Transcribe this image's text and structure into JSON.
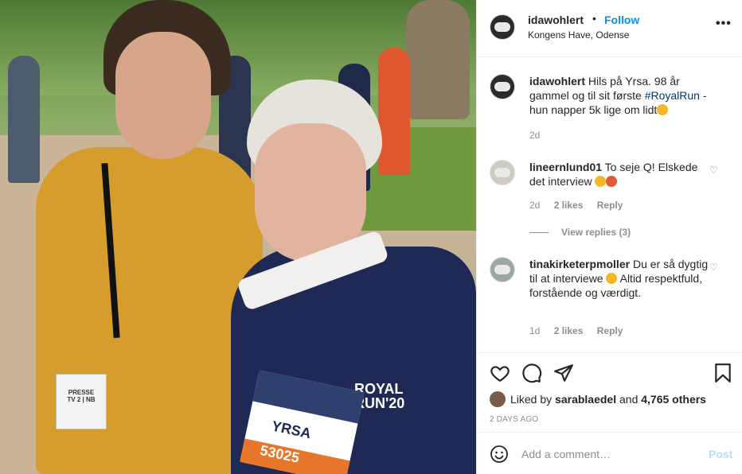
{
  "post": {
    "author": "idawohlert",
    "follow_label": "Follow",
    "location": "Kongens Have, Odense",
    "caption_user": "idawohlert",
    "caption_text_1": "Hils på Yrsa. 98 år gammel og til sit første ",
    "caption_hashtag": "#RoyalRun",
    "caption_text_2": " - hun napper 5k lige om lidt",
    "caption_time": "2d"
  },
  "comments": [
    {
      "user": "lineernlund01",
      "text": "To seje Q! Elskede det interview",
      "time": "2d",
      "likes": "2 likes",
      "reply": "Reply",
      "view_replies": "View replies (3)"
    },
    {
      "user": "tinakirketerpmoller",
      "text": "Du er så dygtig til at interviewe",
      "text_2": " Altid respektfuld, forstående og værdigt.",
      "time": "1d",
      "likes": "2 likes",
      "reply": "Reply"
    }
  ],
  "likes": {
    "prefix": "Liked by ",
    "user": "sarablaedel",
    "and": " and ",
    "others": "4,765 others"
  },
  "date_label": "2 DAYS AGO",
  "add_comment": {
    "placeholder": "Add a comment…",
    "post_label": "Post"
  },
  "photo": {
    "badge_line1": "PRESSE",
    "badge_line2": "TV 2 | NB",
    "shirt_line1": "ROYAL",
    "shirt_line2": "RUN'20",
    "bib_name": "YRSA",
    "bib_number": "53025"
  },
  "colors": {
    "accent": "#0095f6",
    "post_disabled": "#b2dffc",
    "text": "#262626",
    "muted": "#8e8e8e",
    "hashtag": "#00376b"
  },
  "icons": [
    "heart-icon",
    "comment-icon",
    "share-icon",
    "bookmark-icon",
    "emoji-icon",
    "more-icon"
  ]
}
